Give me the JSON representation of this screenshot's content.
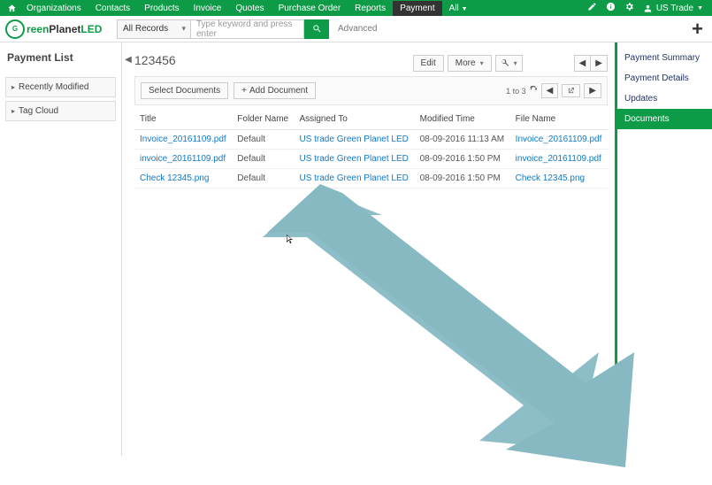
{
  "topnav": {
    "items": [
      "Organizations",
      "Contacts",
      "Products",
      "Invoice",
      "Quotes",
      "Purchase Order",
      "Reports",
      "Payment",
      "All"
    ],
    "active_index": 7,
    "user_label": "US Trade"
  },
  "search": {
    "scope": "All Records",
    "placeholder": "Type keyword and press enter",
    "advanced": "Advanced"
  },
  "logo": {
    "brand_a": "reen",
    "brand_b": "Planet",
    "brand_c": "LED"
  },
  "left": {
    "title": "Payment List",
    "items": [
      "Recently Modified",
      "Tag Cloud"
    ]
  },
  "record": {
    "title": "123456",
    "buttons": {
      "edit": "Edit",
      "more": "More"
    }
  },
  "toolbox": {
    "select": "Select Documents",
    "add": "Add Document",
    "range": "1 to 3"
  },
  "table": {
    "headers": [
      "Title",
      "Folder Name",
      "Assigned To",
      "Modified Time",
      "File Name"
    ],
    "rows": [
      {
        "title": "Invoice_20161109.pdf",
        "folder": "Default",
        "assigned": "US trade Green Planet LED",
        "modified": "08-09-2016 11:13 AM",
        "file": "Invoice_20161109.pdf"
      },
      {
        "title": "invoice_20161109.pdf",
        "folder": "Default",
        "assigned": "US trade Green Planet LED",
        "modified": "08-09-2016 1:50 PM",
        "file": "invoice_20161109.pdf"
      },
      {
        "title": "Check 12345.png",
        "folder": "Default",
        "assigned": "US trade Green Planet LED",
        "modified": "08-09-2016 1:50 PM",
        "file": "Check 12345.png"
      }
    ]
  },
  "right": {
    "items": [
      "Payment Summary",
      "Payment Details",
      "Updates",
      "Documents"
    ],
    "active_index": 3
  }
}
